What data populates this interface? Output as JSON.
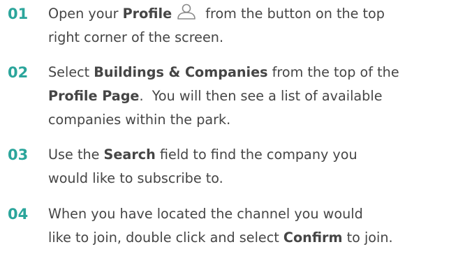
{
  "steps": [
    {
      "number": "01",
      "lines": [
        {
          "before": "Open your ",
          "bold": "Profile",
          "after": " from the button on the top"
        },
        {
          "text": "right corner of the screen."
        }
      ],
      "icon": "person-outline-icon"
    },
    {
      "number": "02",
      "lines": [
        {
          "before": "Select ",
          "bold": "Buildings & Companies",
          "after": " from the top of the"
        },
        {
          "bold": "Profile Page",
          "after": ".  You will then see a list of available"
        },
        {
          "text": "companies within the park."
        }
      ]
    },
    {
      "number": "03",
      "lines": [
        {
          "before": "Use the ",
          "bold": "Search",
          "after": " field to find the company you"
        },
        {
          "text": "would like to subscribe to."
        }
      ]
    },
    {
      "number": "04",
      "lines": [
        {
          "text": "When you have located the channel you would"
        },
        {
          "before": "like to join, double click and select ",
          "bold": "Confirm",
          "after": " to join."
        }
      ]
    }
  ],
  "colors": {
    "accent": "#2ba59b",
    "text": "#454545",
    "icon": "#8a8a8a"
  }
}
